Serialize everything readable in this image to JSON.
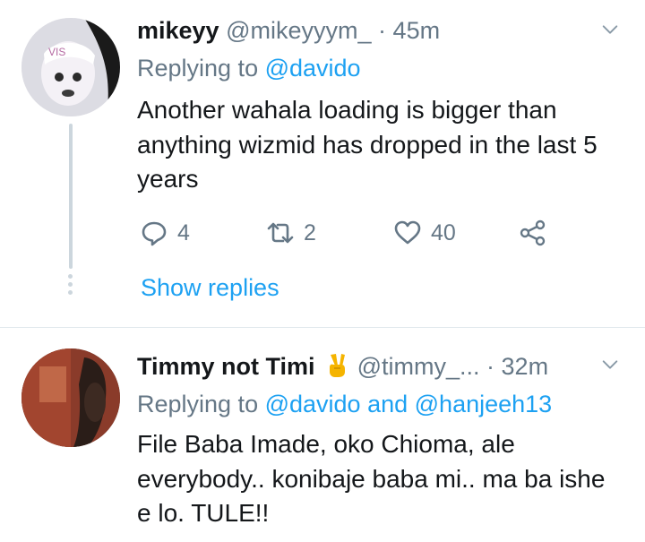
{
  "tweets": [
    {
      "name": "mikeyy",
      "handle": "@mikeyyym_",
      "separator": "·",
      "time": "45m",
      "replying_prefix": "Replying to ",
      "replying_mentions": [
        "@davido"
      ],
      "text": "Another wahala loading is bigger than anything wizmid has dropped in the last 5 years",
      "reply_count": "4",
      "retweet_count": "2",
      "like_count": "40",
      "show_replies": "Show replies"
    },
    {
      "name": "Timmy not Timi",
      "name_emoji": "victory-hand-emoji",
      "handle": "@timmy_...",
      "separator": "·",
      "time": "32m",
      "replying_prefix": "Replying to ",
      "replying_mentions": [
        "@davido",
        "@hanjeeh13"
      ],
      "replying_conjunction": " and ",
      "text": "File Baba Imade, oko Chioma, ale everybody.. konibaje baba mi.. ma ba ishe e lo. TULE!!"
    }
  ],
  "icons": {
    "reply": "reply-icon",
    "retweet": "retweet-icon",
    "like": "heart-icon",
    "share": "share-icon",
    "menu": "chevron-down-icon"
  },
  "colors": {
    "link": "#1da1f2",
    "secondary_text": "#657786",
    "primary_text": "#14171a",
    "divider": "#e1e8ed"
  }
}
